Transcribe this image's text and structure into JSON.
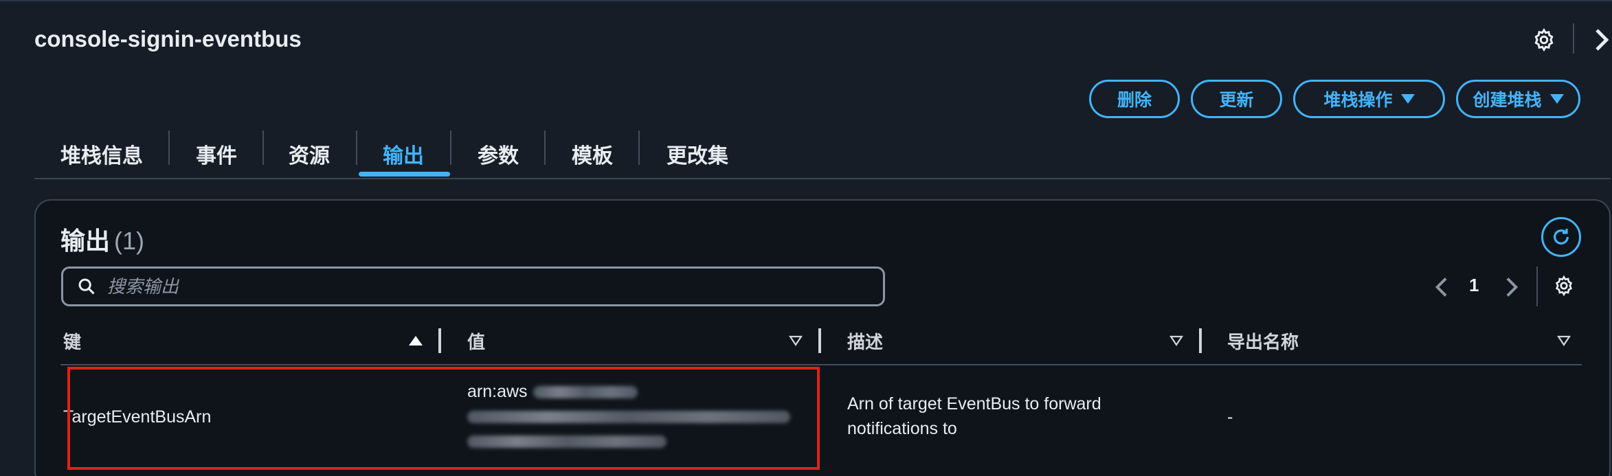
{
  "header": {
    "title": "console-signin-eventbus"
  },
  "actions": {
    "delete_label": "删除",
    "update_label": "更新",
    "stack_actions_label": "堆栈操作",
    "create_stack_label": "创建堆栈"
  },
  "tabs": [
    {
      "label": "堆栈信息"
    },
    {
      "label": "事件"
    },
    {
      "label": "资源"
    },
    {
      "label": "输出"
    },
    {
      "label": "参数"
    },
    {
      "label": "模板"
    },
    {
      "label": "更改集"
    }
  ],
  "active_tab": "输出",
  "outputs": {
    "title": "输出",
    "count": "(1)",
    "search_placeholder": "搜索输出",
    "page": "1",
    "columns": [
      {
        "label": "键",
        "sort": "ascending"
      },
      {
        "label": "值",
        "sort": "none"
      },
      {
        "label": "描述",
        "sort": "none"
      },
      {
        "label": "导出名称",
        "sort": "none"
      }
    ],
    "rows": [
      {
        "key": "TargetEventBusArn",
        "value_visible_prefix": "arn:aws",
        "description_line1": "Arn of target EventBus to forward",
        "description_line2": "notifications to",
        "export_name": "-"
      }
    ]
  },
  "colors": {
    "background": "#161d26",
    "panel": "#0f141a",
    "accent": "#42b4ff",
    "highlight": "#e0211b",
    "text": "#e9edf2",
    "muted": "#8c97a5"
  }
}
